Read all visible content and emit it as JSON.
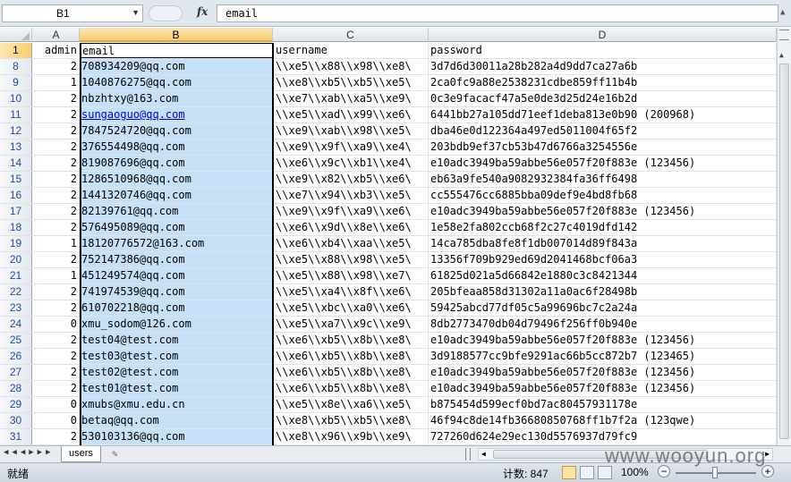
{
  "formula_bar": {
    "name_box": "B1",
    "fx_label": "fx",
    "formula": "email"
  },
  "columns": [
    {
      "letter": "A",
      "selected": false
    },
    {
      "letter": "B",
      "selected": true
    },
    {
      "letter": "C",
      "selected": false
    },
    {
      "letter": "D",
      "selected": false
    }
  ],
  "header_row": {
    "row": "1",
    "admin": "admin",
    "email": "email",
    "username": "username",
    "password": "password"
  },
  "rows": [
    {
      "row": "8",
      "admin": "2",
      "email": "708934209@qq.com",
      "username": "\\\\xe5\\\\x88\\\\x98\\\\xe8\\",
      "password": "3d7d6d30011a28b282a4d9dd7ca27a6b"
    },
    {
      "row": "9",
      "admin": "1",
      "email": "1040876275@qq.com",
      "username": "\\\\xe8\\\\xb5\\\\xb5\\\\xe5\\",
      "password": "2ca0fc9a88e2538231cdbe859ff11b4b"
    },
    {
      "row": "10",
      "admin": "2",
      "email": "nbzhtxy@163.com",
      "username": "\\\\xe7\\\\xab\\\\xa5\\\\xe9\\",
      "password": "0c3e9facacf47a5e0de3d25d24e16b2d"
    },
    {
      "row": "11",
      "admin": "2",
      "email": "sungaoguo@qq.com",
      "username": "\\\\xe5\\\\xad\\\\x99\\\\xe6\\",
      "password": "6441bb27a105dd71eef1deba813e0b90 (200968)"
    },
    {
      "row": "12",
      "admin": "2",
      "email": "7847524720@qq.com",
      "username": "\\\\xe9\\\\xab\\\\x98\\\\xe5\\",
      "password": "dba46e0d122364a497ed5011004f65f2"
    },
    {
      "row": "13",
      "admin": "2",
      "email": "376554498@qq.com",
      "username": "\\\\xe9\\\\x9f\\\\xa9\\\\xe4\\",
      "password": "203bdb9ef37cb53b47d6766a3254556e"
    },
    {
      "row": "14",
      "admin": "2",
      "email": "819087696@qq.com",
      "username": "\\\\xe6\\\\x9c\\\\xb1\\\\xe4\\",
      "password": "e10adc3949ba59abbe56e057f20f883e (123456)"
    },
    {
      "row": "15",
      "admin": "2",
      "email": "1286510968@qq.com",
      "username": "\\\\xe9\\\\x82\\\\xb5\\\\xe6\\",
      "password": "eb63a9fe540a9082932384fa36ff6498"
    },
    {
      "row": "16",
      "admin": "2",
      "email": "1441320746@qq.com",
      "username": "\\\\xe7\\\\x94\\\\xb3\\\\xe5\\",
      "password": "cc555476cc6885bba09def9e4bd8fb68"
    },
    {
      "row": "17",
      "admin": "2",
      "email": "82139761@qq.com",
      "username": "\\\\xe9\\\\x9f\\\\xa9\\\\xe6\\",
      "password": "e10adc3949ba59abbe56e057f20f883e (123456)"
    },
    {
      "row": "18",
      "admin": "2",
      "email": "576495089@qq.com",
      "username": "\\\\xe6\\\\x9d\\\\x8e\\\\xe6\\",
      "password": "1e58e2fa802ccb68f2c27c4019dfd142"
    },
    {
      "row": "19",
      "admin": "1",
      "email": "18120776572@163.com",
      "username": "\\\\xe6\\\\xb4\\\\xaa\\\\xe5\\",
      "password": "14ca785dba8fe8f1db007014d89f843a"
    },
    {
      "row": "20",
      "admin": "2",
      "email": "752147386@qq.com",
      "username": "\\\\xe5\\\\x88\\\\x98\\\\xe5\\",
      "password": "13356f709b929ed69d2041468bcf06a3"
    },
    {
      "row": "21",
      "admin": "1",
      "email": "451249574@qq.com",
      "username": "\\\\xe5\\\\x88\\\\x98\\\\xe7\\",
      "password": "61825d021a5d66842e1880c3c8421344"
    },
    {
      "row": "22",
      "admin": "2",
      "email": "741974539@qq.com",
      "username": "\\\\xe5\\\\xa4\\\\x8f\\\\xe6\\",
      "password": "205bfeaa858d31302a11a0ac6f28498b"
    },
    {
      "row": "23",
      "admin": "2",
      "email": "610702218@qq.com",
      "username": "\\\\xe5\\\\xbc\\\\xa0\\\\xe6\\",
      "password": "59425abcd77df05c5a99696bc7c2a24a"
    },
    {
      "row": "24",
      "admin": "0",
      "email": "xmu_sodom@126.com",
      "username": "\\\\xe5\\\\xa7\\\\x9c\\\\xe9\\",
      "password": "8db2773470db04d79496f256ff0b940e"
    },
    {
      "row": "25",
      "admin": "2",
      "email": "test04@test.com",
      "username": "\\\\xe6\\\\xb5\\\\x8b\\\\xe8\\",
      "password": "e10adc3949ba59abbe56e057f20f883e (123456)"
    },
    {
      "row": "26",
      "admin": "2",
      "email": "test03@test.com",
      "username": "\\\\xe6\\\\xb5\\\\x8b\\\\xe8\\",
      "password": "3d9188577cc9bfe9291ac66b5cc872b7 (123465)"
    },
    {
      "row": "27",
      "admin": "2",
      "email": "test02@test.com",
      "username": "\\\\xe6\\\\xb5\\\\x8b\\\\xe8\\",
      "password": "e10adc3949ba59abbe56e057f20f883e (123456)"
    },
    {
      "row": "28",
      "admin": "2",
      "email": "test01@test.com",
      "username": "\\\\xe6\\\\xb5\\\\x8b\\\\xe8\\",
      "password": "e10adc3949ba59abbe56e057f20f883e (123456)"
    },
    {
      "row": "29",
      "admin": "0",
      "email": "xmubs@xmu.edu.cn",
      "username": "\\\\xe5\\\\x8e\\\\xa6\\\\xe5\\",
      "password": "b875454d599ecf0bd7ac80457931178e"
    },
    {
      "row": "30",
      "admin": "0",
      "email": "betaq@qq.com",
      "username": "\\\\xe8\\\\xb5\\\\xb5\\\\xe8\\",
      "password": "46f94c8de14fb36680850768ff1b7f2a (123qwe)"
    },
    {
      "row": "31",
      "admin": "2",
      "email": "530103136@qq.com",
      "username": "\\\\xe8\\\\x96\\\\x9b\\\\xe9\\",
      "password": "727260d624e29ec130d5576937d79fc9"
    }
  ],
  "linked_row": "11",
  "sheet": {
    "tab": "users"
  },
  "status": {
    "ready": "就绪",
    "count": "计数: 847",
    "zoom": "100%"
  },
  "watermark": "www.wooyun.org"
}
